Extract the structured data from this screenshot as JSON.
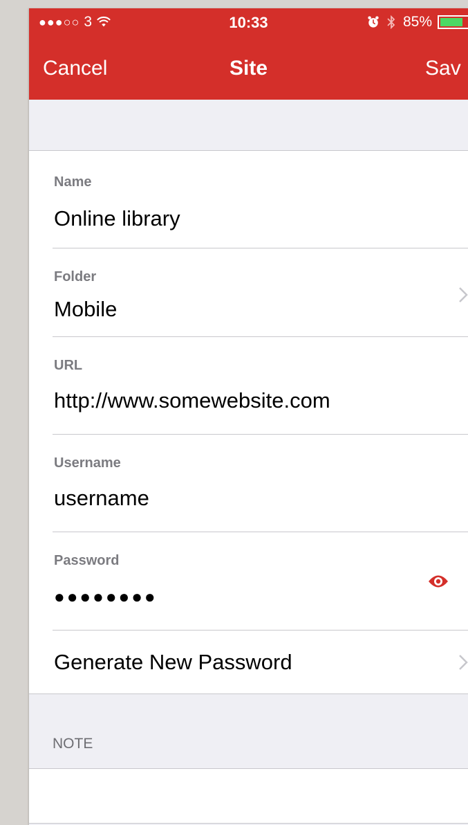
{
  "status_bar": {
    "signal": "●●●○○",
    "carrier": "3",
    "time": "10:33",
    "battery_percent": "85%",
    "battery_level": 0.85,
    "icons": [
      "wifi-icon",
      "alarm-icon",
      "bluetooth-icon",
      "battery-icon"
    ]
  },
  "nav": {
    "cancel_label": "Cancel",
    "title": "Site",
    "save_label": "Sav"
  },
  "form": {
    "name": {
      "label": "Name",
      "value": "Online library"
    },
    "folder": {
      "label": "Folder",
      "value": "Mobile"
    },
    "url": {
      "label": "URL",
      "value": "http://www.somewebsite.com"
    },
    "username": {
      "label": "Username",
      "value": "username"
    },
    "password": {
      "label": "Password",
      "value": "●●●●●●●●"
    },
    "generate_label": "Generate New Password"
  },
  "note": {
    "header": "NOTE",
    "value": ""
  },
  "colors": {
    "accent": "#d42f2a",
    "background": "#efeff4",
    "separator": "#c8c7cc",
    "label": "#7b7b80",
    "battery_green": "#4cd964"
  }
}
